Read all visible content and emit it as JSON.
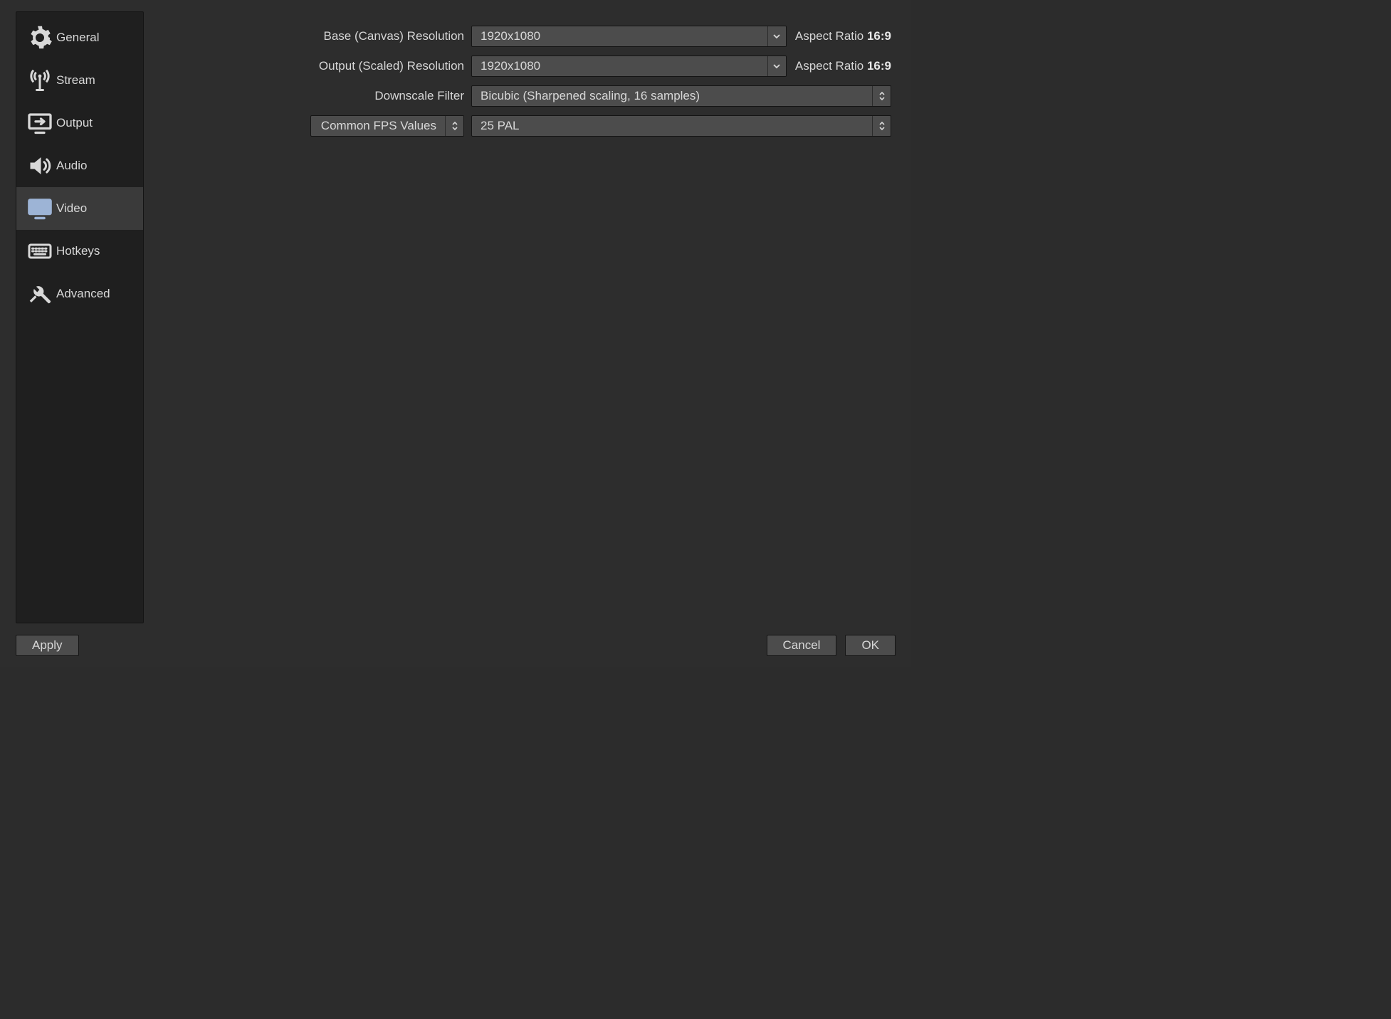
{
  "sidebar": {
    "items": [
      {
        "label": "General"
      },
      {
        "label": "Stream"
      },
      {
        "label": "Output"
      },
      {
        "label": "Audio"
      },
      {
        "label": "Video"
      },
      {
        "label": "Hotkeys"
      },
      {
        "label": "Advanced"
      }
    ],
    "selected_index": 4
  },
  "video": {
    "base_label": "Base (Canvas) Resolution",
    "base_value": "1920x1080",
    "aspect_prefix": "Aspect Ratio ",
    "base_aspect": "16:9",
    "output_label": "Output (Scaled) Resolution",
    "output_value": "1920x1080",
    "output_aspect": "16:9",
    "downscale_label": "Downscale Filter",
    "downscale_value": "Bicubic (Sharpened scaling, 16 samples)",
    "fps_mode_label": "Common FPS Values",
    "fps_value": "25 PAL"
  },
  "buttons": {
    "apply": "Apply",
    "cancel": "Cancel",
    "ok": "OK"
  },
  "icons": {
    "general": "gear-icon",
    "stream": "antenna-icon",
    "output": "output-icon",
    "audio": "speaker-icon",
    "video": "monitor-icon",
    "hotkeys": "keyboard-icon",
    "advanced": "tools-icon",
    "chevron_down": "chevron-down-icon",
    "stepper": "stepper-icon"
  }
}
